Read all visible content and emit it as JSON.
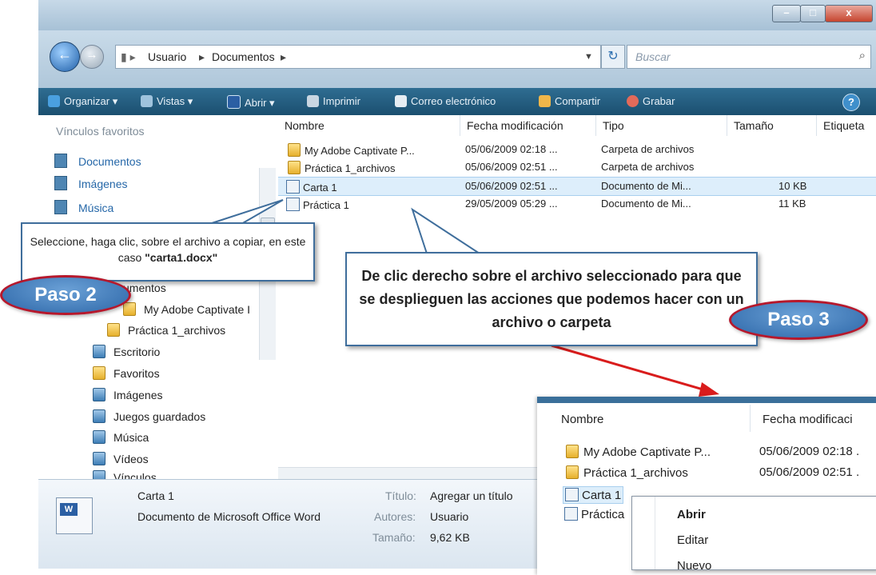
{
  "window": {
    "buttons": {
      "minimize": "–",
      "maximize": "□",
      "close": "x"
    }
  },
  "nav": {
    "back": "←",
    "forward": "→",
    "breadcrumb": [
      "Usuario",
      "Documentos"
    ],
    "search_placeholder": "Buscar"
  },
  "toolbar": {
    "items": [
      "Organizar ▾",
      "Vistas ▾",
      "Abrir ▾",
      "Imprimir",
      "Correo electrónico",
      "Compartir",
      "Grabar"
    ],
    "help": "?"
  },
  "sidebar": {
    "favorites_title": "Vínculos favoritos",
    "favorites": [
      "Documentos",
      "Imágenes",
      "Música"
    ],
    "tree": [
      {
        "label": "umentos",
        "icon": "folder"
      },
      {
        "label": "My Adobe Captivate I",
        "icon": "folder"
      },
      {
        "label": "Práctica 1_archivos",
        "icon": "folder"
      },
      {
        "label": "Escritorio",
        "icon": "folder"
      },
      {
        "label": "Favoritos",
        "icon": "folder"
      },
      {
        "label": "Imágenes",
        "icon": "folder"
      },
      {
        "label": "Juegos guardados",
        "icon": "folder"
      },
      {
        "label": "Música",
        "icon": "folder"
      },
      {
        "label": "Vídeos",
        "icon": "folder"
      },
      {
        "label": "Vínculos",
        "icon": "folder"
      }
    ]
  },
  "filelist": {
    "columns": [
      "Nombre",
      "Fecha modificación",
      "Tipo",
      "Tamaño",
      "Etiqueta"
    ],
    "rows": [
      {
        "name": "My Adobe Captivate P...",
        "date": "05/06/2009 02:18 ...",
        "type": "Carpeta de archivos",
        "size": "",
        "icon": "folder"
      },
      {
        "name": "Práctica 1_archivos",
        "date": "05/06/2009 02:51 ...",
        "type": "Carpeta de archivos",
        "size": "",
        "icon": "folder"
      },
      {
        "name": "Carta 1",
        "date": "05/06/2009 02:51 ...",
        "type": "Documento de Mi...",
        "size": "10 KB",
        "icon": "word-doc"
      },
      {
        "name": "Práctica 1",
        "date": "29/05/2009 05:29 ...",
        "type": "Documento de Mi...",
        "size": "11 KB",
        "icon": "word-doc"
      }
    ]
  },
  "details": {
    "filename": "Carta 1",
    "filetype": "Documento de Microsoft Office Word",
    "title_label": "Título:",
    "title_value": "Agregar un título",
    "authors_label": "Autores:",
    "authors_value": "Usuario",
    "size_label": "Tamaño:",
    "size_value": "9,62 KB"
  },
  "callouts": {
    "step2_text": "Seleccione, haga clic, sobre el archivo a copiar, en este caso ",
    "step2_file": "\"carta1.docx\"",
    "step2_badge": "Paso 2",
    "step3_text": "De clic derecho sobre el archivo seleccionado para que se desplieguen las acciones que podemos hacer con un archivo o carpeta",
    "step3_badge": "Paso 3"
  },
  "inset": {
    "columns": [
      "Nombre",
      "Fecha modificaci"
    ],
    "rows": [
      {
        "name": "My Adobe Captivate P...",
        "date": "05/06/2009 02:18 ."
      },
      {
        "name": "Práctica 1_archivos",
        "date": "05/06/2009 02:51 ."
      },
      {
        "name": "Carta 1",
        "date": ""
      },
      {
        "name": "Práctica",
        "date": ""
      }
    ],
    "context_menu": [
      "Abrir",
      "Editar",
      "Nuevo"
    ]
  },
  "colors": {
    "toolbar": "#1f5a7e",
    "callout_border": "#3f6e9c",
    "badge_fill": "#3a78bd",
    "badge_border": "#b6182c",
    "arrow": "#d91c1c",
    "selection": "#ddeefb"
  }
}
